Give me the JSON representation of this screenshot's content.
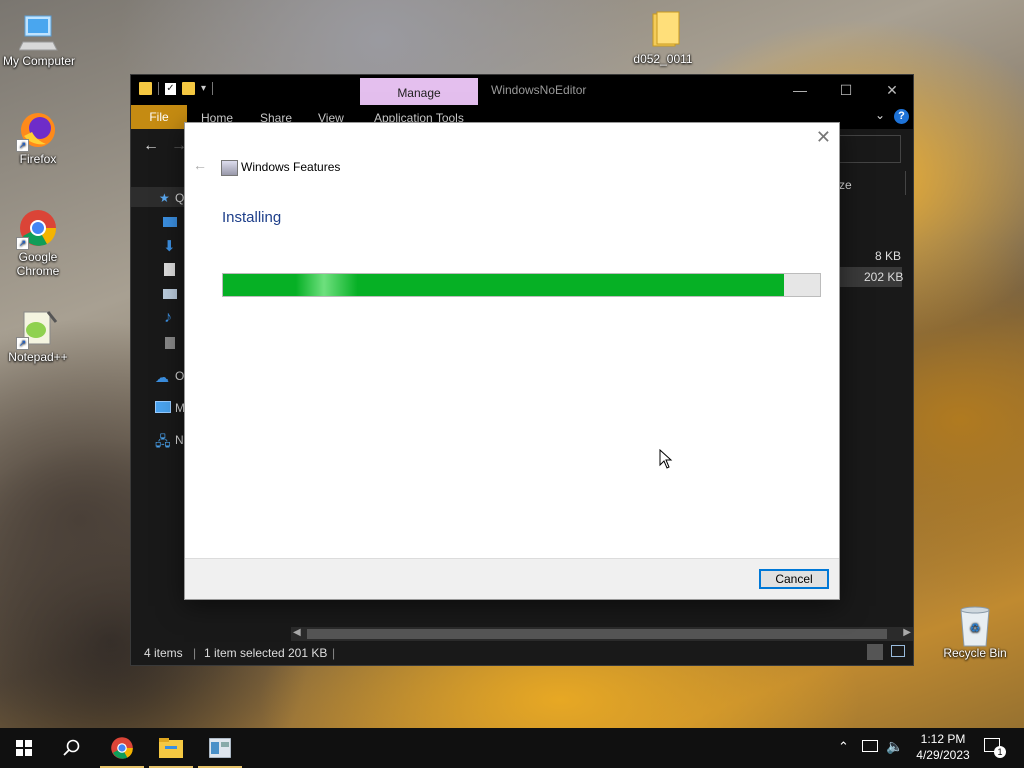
{
  "desktop": {
    "icons": [
      {
        "label": "My Computer",
        "icon": "computer-icon"
      },
      {
        "label": "Firefox",
        "icon": "firefox-icon"
      },
      {
        "label": "Google Chrome",
        "icon": "chrome-icon"
      },
      {
        "label": "Notepad++",
        "icon": "notepadpp-icon"
      },
      {
        "label": "d052_0011",
        "icon": "folder-icon"
      },
      {
        "label": "Recycle Bin",
        "icon": "recycle-bin-icon"
      }
    ]
  },
  "explorer": {
    "title": "WindowsNoEditor",
    "context_tab": "Manage",
    "ribbon_tabs": [
      "File",
      "Home",
      "Share",
      "View",
      "Application Tools"
    ],
    "column_header_fragment": "ze",
    "sizes": [
      "8 KB",
      "202 KB"
    ],
    "sidebar_fragments": [
      "Q",
      "O",
      "M",
      "N"
    ],
    "status": {
      "items": "4 items",
      "selected": "1 item selected",
      "size": "201 KB"
    }
  },
  "dialog": {
    "title": "Windows Features",
    "heading": "Installing",
    "progress_fraction": 0.94,
    "cancel_label": "Cancel"
  },
  "taskbar": {
    "time": "1:12 PM",
    "date": "4/29/2023",
    "notification_count": "1",
    "items": [
      "start-icon",
      "search-icon",
      "chrome-icon",
      "file-explorer-icon",
      "windows-features-icon"
    ]
  },
  "colors": {
    "progress_fill": "#06b025",
    "manage_tab": "#e4bfee",
    "file_tab": "#c58b12",
    "heading": "#1e3f8a"
  }
}
